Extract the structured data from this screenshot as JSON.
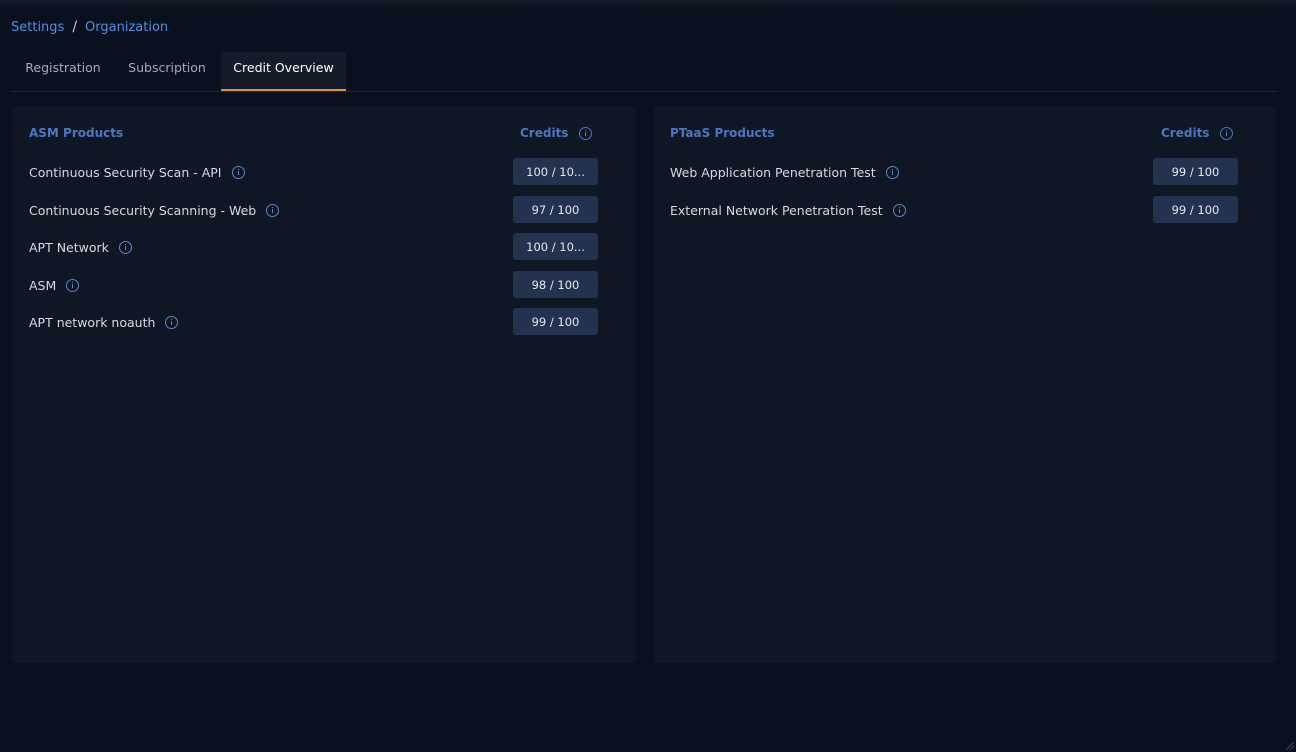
{
  "breadcrumb": {
    "items": [
      "Settings",
      "Organization"
    ],
    "separator": "/"
  },
  "tabs": [
    {
      "label": "Registration",
      "active": false
    },
    {
      "label": "Subscription",
      "active": false
    },
    {
      "label": "Credit Overview",
      "active": true
    }
  ],
  "asm": {
    "title": "ASM Products",
    "credits_label": "Credits",
    "items": [
      {
        "name": "Continuous Security Scan - API",
        "credits": "100 / 10..."
      },
      {
        "name": "Continuous Security Scanning - Web",
        "credits": "97 / 100"
      },
      {
        "name": "APT Network",
        "credits": "100 / 10..."
      },
      {
        "name": "ASM",
        "credits": "98 / 100"
      },
      {
        "name": "APT network noauth",
        "credits": "99 / 100"
      }
    ]
  },
  "ptaas": {
    "title": "PTaaS Products",
    "credits_label": "Credits",
    "items": [
      {
        "name": "Web Application Penetration Test",
        "credits": "99 / 100"
      },
      {
        "name": "External Network Penetration Test",
        "credits": "99 / 100"
      }
    ]
  },
  "colors": {
    "accent": "#4f8ee0",
    "active_tab_underline": "#e0913e",
    "badge_bg": "#22324f",
    "panel_bg": "#0f1624",
    "page_bg": "#0a111e"
  },
  "icons": {
    "info": "info-icon"
  }
}
